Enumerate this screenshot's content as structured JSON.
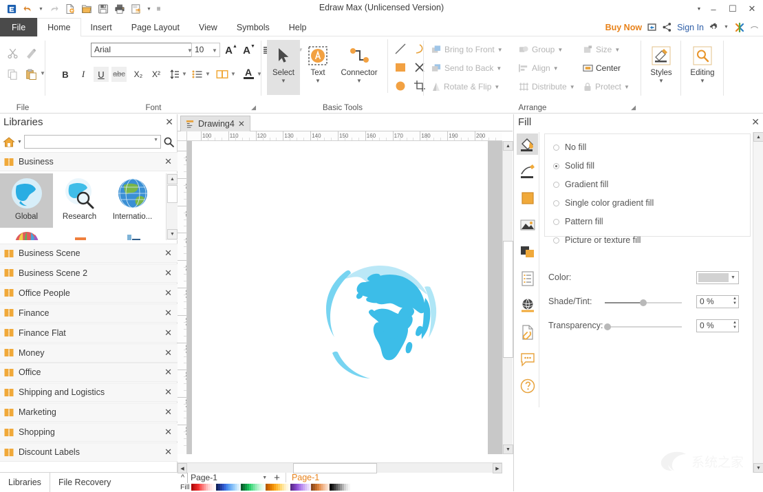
{
  "window": {
    "title": "Edraw Max (Unlicensed Version)",
    "minimize": "–",
    "maximize": "☐",
    "close": "✕"
  },
  "quick_access": {
    "logo": "edraw-logo",
    "items": [
      {
        "name": "undo-button",
        "glyph": "↶"
      },
      {
        "name": "undo-dropdown",
        "glyph": "▾"
      },
      {
        "name": "redo-button",
        "glyph": "↷"
      },
      {
        "name": "new-document-button",
        "glyph": "new"
      },
      {
        "name": "open-file-button",
        "glyph": "open"
      },
      {
        "name": "save-button",
        "glyph": "save"
      },
      {
        "name": "print-button",
        "glyph": "print"
      },
      {
        "name": "export-button",
        "glyph": "export"
      },
      {
        "name": "export-dropdown",
        "glyph": "▾"
      },
      {
        "name": "customize-qat-button",
        "glyph": "≡"
      }
    ]
  },
  "ribbon_tabs": [
    {
      "label": "File",
      "active": false,
      "file": true
    },
    {
      "label": "Home",
      "active": true,
      "file": false
    },
    {
      "label": "Insert",
      "active": false,
      "file": false
    },
    {
      "label": "Page Layout",
      "active": false,
      "file": false
    },
    {
      "label": "View",
      "active": false,
      "file": false
    },
    {
      "label": "Symbols",
      "active": false,
      "file": false
    },
    {
      "label": "Help",
      "active": false,
      "file": false
    }
  ],
  "account_bar": {
    "buy_now": "Buy Now",
    "sign_in": "Sign In",
    "share_icon": "share-icon",
    "cloud_icon": "cloud-icon",
    "settings_icon": "gear-icon",
    "apps_icon": "apps-icon",
    "expand_icon": "collapse-ribbon-icon"
  },
  "ribbon": {
    "groups": [
      {
        "label": "File"
      },
      {
        "label": "Font"
      },
      {
        "label": "Basic Tools"
      },
      {
        "label": "Arrange"
      }
    ],
    "file_group": {
      "cut": "cut-icon",
      "format_painter": "format-painter-icon",
      "copy": "copy-icon",
      "paste": "paste-icon"
    },
    "font_group": {
      "font_family": "Arial",
      "font_size": "10",
      "grow_font": "A",
      "shrink_font": "A",
      "bold": "B",
      "italic": "I",
      "underline": "U",
      "strikethrough": "abc",
      "subscript": "X₂",
      "superscript": "X²",
      "align_label": "align-icon",
      "text_effects_label": "curve-text-icon",
      "line_spacing": "line-spacing-icon",
      "bullets": "bullets-icon",
      "text_box": "text-box-icon",
      "font_color": "A"
    },
    "basic_tools": {
      "select": "Select",
      "text": "Text",
      "connector": "Connector",
      "line_tool": "line-tool-icon",
      "arc_tool": "arc-tool-icon",
      "rectangle_tool": "rectangle-tool-icon",
      "close_shape_tool": "close-shape-icon",
      "ellipse_tool": "ellipse-tool-icon",
      "crop_tool": "crop-tool-icon"
    },
    "arrange": {
      "bring_to_front": "Bring to Front",
      "send_to_back": "Send to Back",
      "rotate_flip": "Rotate & Flip",
      "group": "Group",
      "align": "Align",
      "distribute": "Distribute",
      "size": "Size",
      "center": "Center",
      "protect": "Protect"
    },
    "styles": {
      "label": "Styles",
      "icon": "styles-icon"
    },
    "editing": {
      "label": "Editing",
      "icon": "search-editing-icon"
    }
  },
  "libraries": {
    "title": "Libraries",
    "close": "✕",
    "search_placeholder": "",
    "search_value": "",
    "home_icon": "home-icon",
    "search_icon": "search-icon",
    "category": {
      "label": "Business",
      "icon": "library-icon",
      "close": "✕"
    },
    "shapes": [
      {
        "label": "Global",
        "icon": "globe-blue-icon",
        "selected": true
      },
      {
        "label": "Research",
        "icon": "globe-magnifier-icon",
        "selected": false
      },
      {
        "label": "Internatio...",
        "icon": "globe-green-icon",
        "selected": false
      },
      {
        "label": "",
        "icon": "balloon-icon",
        "selected": false
      },
      {
        "label": "",
        "icon": "buildings-orange-icon",
        "selected": false
      },
      {
        "label": "",
        "icon": "skyscraper-icon",
        "selected": false
      }
    ],
    "list": [
      {
        "label": "Business Scene",
        "close": "✕"
      },
      {
        "label": "Business Scene 2",
        "close": "✕"
      },
      {
        "label": "Office People",
        "close": "✕"
      },
      {
        "label": "Finance",
        "close": "✕"
      },
      {
        "label": "Finance Flat",
        "close": "✕"
      },
      {
        "label": "Money",
        "close": "✕"
      },
      {
        "label": "Office",
        "close": "✕"
      },
      {
        "label": "Shipping and Logistics",
        "close": "✕"
      },
      {
        "label": "Marketing",
        "close": "✕"
      },
      {
        "label": "Shopping",
        "close": "✕"
      },
      {
        "label": "Discount Labels",
        "close": "✕"
      }
    ],
    "bottom_tabs": [
      {
        "label": "Libraries",
        "active": true
      },
      {
        "label": "File Recovery",
        "active": false
      }
    ]
  },
  "document": {
    "tab": {
      "label": "Drawing4",
      "close": "✕",
      "icon": "document-icon"
    },
    "ruler_h": [
      "100",
      "110",
      "120",
      "130",
      "140",
      "150",
      "160",
      "170",
      "180",
      "190",
      "200"
    ],
    "ruler_v": [
      "90",
      "80",
      "70",
      "80",
      "90",
      "100",
      "110",
      "120",
      "130",
      "140",
      "150"
    ],
    "canvas_shape": "globe-blue-artwork",
    "shape_color": "#3CBDE8"
  },
  "page_bar": {
    "collapse_icon": "chevron-up-icon",
    "page_selector": "Page-1",
    "add_page": "+",
    "page_tab": "Page-1"
  },
  "fill_bar": {
    "label": "Fill",
    "colors": [
      "#b00000",
      "#c81818",
      "#e02020",
      "#f03030",
      "#f85858",
      "#fb7878",
      "#fd9898",
      "#feb8b8",
      "#fed0d0",
      "#fee2e2",
      "#fff0f0",
      "#fffafa",
      "#12235c",
      "#1b3180",
      "#2440a5",
      "#2e55c6",
      "#3a6ee0",
      "#4a8bee",
      "#5fa3f2",
      "#79b6f6",
      "#93c8f9",
      "#b0dbfc",
      "#cfeafd",
      "#e6f4fe",
      "#0a5a2a",
      "#0d7a38",
      "#119947",
      "#16b856",
      "#2fd06e",
      "#55dd8a",
      "#78e6a4",
      "#9aeeba",
      "#b8f3cf",
      "#d2f8e0",
      "#e6fcee",
      "#f3fef7",
      "#b85c00",
      "#d06a00",
      "#e07b00",
      "#ef8f06",
      "#fba41a",
      "#ffb733",
      "#ffc955",
      "#ffda7a",
      "#ffe6a0",
      "#fff0c4",
      "#fff7e0",
      "#fffcf2",
      "#5b2c8a",
      "#6d36a6",
      "#8043c2",
      "#9457d8",
      "#a771e6",
      "#b98bee",
      "#c9a5f3",
      "#d8bef8",
      "#e6d4fb",
      "#f1e6fd",
      "#8a4a1e",
      "#a65a24",
      "#c26c2c",
      "#d87f3c",
      "#e6975c",
      "#eeae7f",
      "#f4c3a0",
      "#f9d6bf",
      "#fce6da",
      "#000000",
      "#1e1e1e",
      "#3c3c3c",
      "#5a5a5a",
      "#787878",
      "#969696",
      "#b4b4b4",
      "#d2d2d2",
      "#e6e6e6",
      "#f5f5f5"
    ]
  },
  "fill_panel": {
    "title": "Fill",
    "close": "✕",
    "rail": [
      {
        "name": "fill-tool-icon",
        "selected": true
      },
      {
        "name": "line-tool-icon",
        "selected": false
      },
      {
        "name": "shadow-tool-icon",
        "selected": false
      },
      {
        "name": "picture-tool-icon",
        "selected": false
      },
      {
        "name": "layers-tool-icon",
        "selected": false
      },
      {
        "name": "properties-tool-icon",
        "selected": false
      },
      {
        "name": "hyperlink-tool-icon",
        "selected": false
      },
      {
        "name": "attachment-tool-icon",
        "selected": false
      },
      {
        "name": "comment-tool-icon",
        "selected": false
      },
      {
        "name": "help-tool-icon",
        "selected": false
      }
    ],
    "fill_options": [
      {
        "label": "No fill",
        "selected": false
      },
      {
        "label": "Solid fill",
        "selected": true
      },
      {
        "label": "Gradient fill",
        "selected": false
      },
      {
        "label": "Single color gradient fill",
        "selected": false
      },
      {
        "label": "Pattern fill",
        "selected": false
      },
      {
        "label": "Picture or texture fill",
        "selected": false
      }
    ],
    "properties": {
      "color_label": "Color:",
      "color_value": "#d2d2d2",
      "shade_label": "Shade/Tint:",
      "shade_value": "0 %",
      "shade_percent": 50,
      "transparency_label": "Transparency:",
      "transparency_value": "0 %",
      "transparency_percent": 0
    }
  },
  "watermark": {
    "text": "系统之家"
  }
}
